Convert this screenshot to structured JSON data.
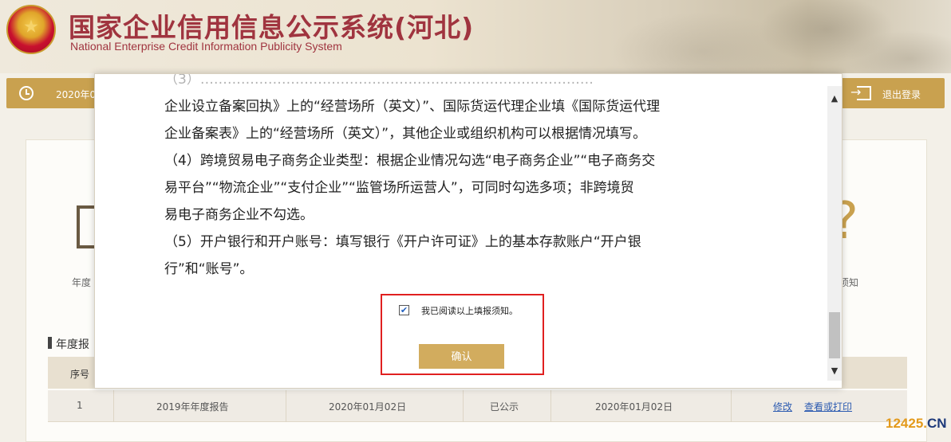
{
  "header": {
    "title_cn": "国家企业信用信息公示系统(河北)",
    "title_en": "National Enterprise Credit Information Publicity System"
  },
  "topbar": {
    "date": "2020年0",
    "logout_label": "退出登录"
  },
  "main": {
    "report_label": "年度",
    "notice_label": "须知",
    "section_title": "年度报",
    "table": {
      "header_no": "序号",
      "row": {
        "no": "1",
        "report_name": "2019年年度报告",
        "submit_date": "2020年01月02日",
        "status": "已公示",
        "publish_date": "2020年01月02日",
        "action_edit": "修改",
        "action_view": "查看或打印"
      }
    }
  },
  "modal": {
    "lines": [
      "企业设立备案回执》上的“经营场所（英文）”、国际货运代理企业填《国际货运代理",
      "企业备案表》上的“经营场所（英文）”，其他企业或组织机构可以根据情况填写。",
      "（4）跨境贸易电子商务企业类型：根据企业情况勾选“电子商务企业”“电子商务交",
      "易平台”“物流企业”“支付企业”“监管场所运营人”，可同时勾选多项；非跨境贸",
      "易电子商务企业不勾选。",
      "（5）开户银行和开户账号：填写银行《开户许可证》上的基本存款账户“开户银",
      "行”和“账号”。"
    ],
    "checkbox_label": "我已阅读以上填报须知。",
    "checkbox_checked": true,
    "confirm_label": "确认"
  },
  "watermark": {
    "number": "12425",
    "dot": ".",
    "suffix": "CN"
  },
  "colors": {
    "brand_red": "#a0343f",
    "gold": "#c9a14f",
    "button_gold": "#d2ac5e",
    "highlight_red": "#e02020",
    "link_blue": "#2b5ab0"
  }
}
